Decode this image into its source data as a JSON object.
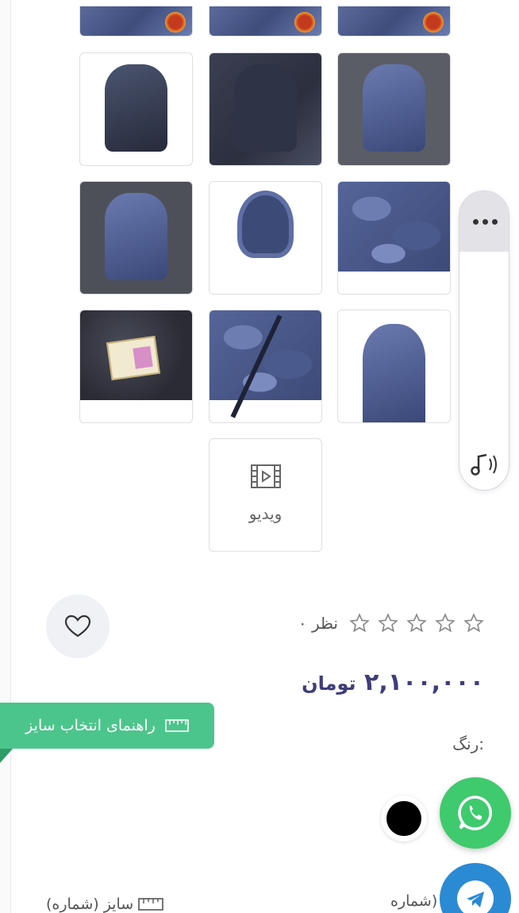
{
  "gallery": {
    "video_label": "ویدیو"
  },
  "product": {
    "reviews_text": "۰ نظر",
    "rating": 0,
    "rating_max": 5,
    "price": "۲,۱۰۰,۰۰۰",
    "currency": "تومان",
    "color_label": "رنگ:",
    "selected_color": "#000000",
    "size_field_right": "شماره)",
    "size_field_left": "سایز (شماره)"
  },
  "size_guide": {
    "label": "راهنمای انتخاب سایز",
    "color": "#4cc58c"
  },
  "side_panel": {
    "more_icon": "more-dots-icon",
    "audio_icon": "music-note-icon"
  },
  "contact": {
    "whatsapp_color": "#3fca6e",
    "telegram_color": "#2a8ad4"
  }
}
